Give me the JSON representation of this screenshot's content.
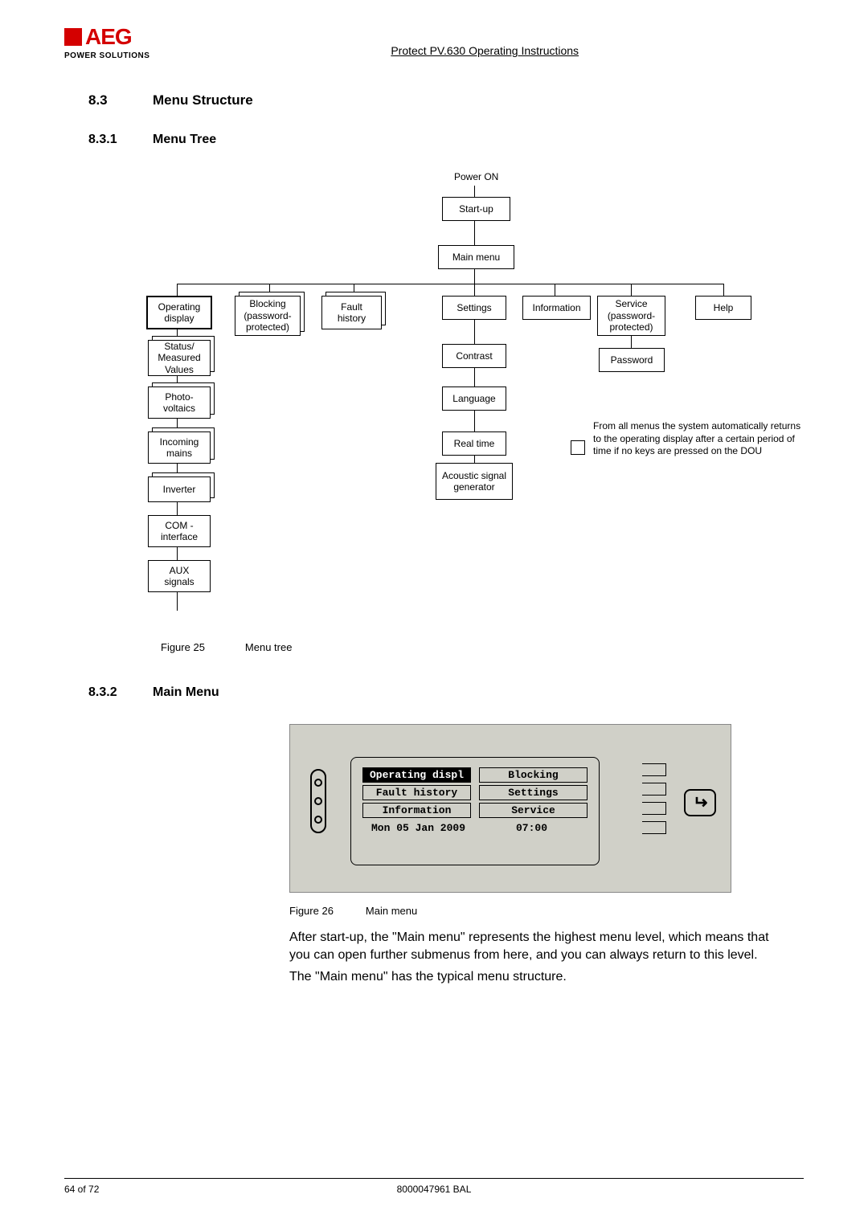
{
  "header": {
    "logo_brand": "AEG",
    "logo_sub": "POWER SOLUTIONS",
    "doc_title": "Protect PV.630 Operating Instructions"
  },
  "section": {
    "num": "8.3",
    "title": "Menu Structure"
  },
  "sub1": {
    "num": "8.3.1",
    "title": "Menu Tree"
  },
  "tree": {
    "power_on": "Power ON",
    "startup": "Start-up",
    "main_menu": "Main menu",
    "row": {
      "operating": "Operating display",
      "blocking": "Blocking (password-protected)",
      "fault": "Fault history",
      "settings": "Settings",
      "information": "Information",
      "service": "Service (password-protected)",
      "help": "Help"
    },
    "op_children": [
      "Status/ Measured Values",
      "Photo-voltaics",
      "Incoming mains",
      "Inverter",
      "COM - interface",
      "AUX signals"
    ],
    "settings_children": [
      "Contrast",
      "Language",
      "Real time",
      "Acoustic signal generator"
    ],
    "service_children": [
      "Password"
    ],
    "note": "From all menus the system automatically returns to the operating display after a certain period of time if no keys are pressed on the DOU"
  },
  "fig25": {
    "label": "Figure 25",
    "caption": "Menu tree"
  },
  "sub2": {
    "num": "8.3.2",
    "title": "Main Menu"
  },
  "lcd": {
    "r1a": "Operating displ",
    "r1b": "Blocking",
    "r2a": "Fault history",
    "r2b": "Settings",
    "r3a": "Information",
    "r3b": "Service",
    "date": "Mon 05 Jan 2009",
    "time": "07:00"
  },
  "fig26": {
    "label": "Figure 26",
    "caption": "Main menu"
  },
  "para1": "After start-up, the \"Main menu\" represents the highest menu level, which means that you can open further submenus from here, and you can always return to this level.",
  "para2": "The \"Main menu\" has the typical menu structure.",
  "footer": {
    "page": "64 of 72",
    "docnum": "8000047961 BAL"
  }
}
